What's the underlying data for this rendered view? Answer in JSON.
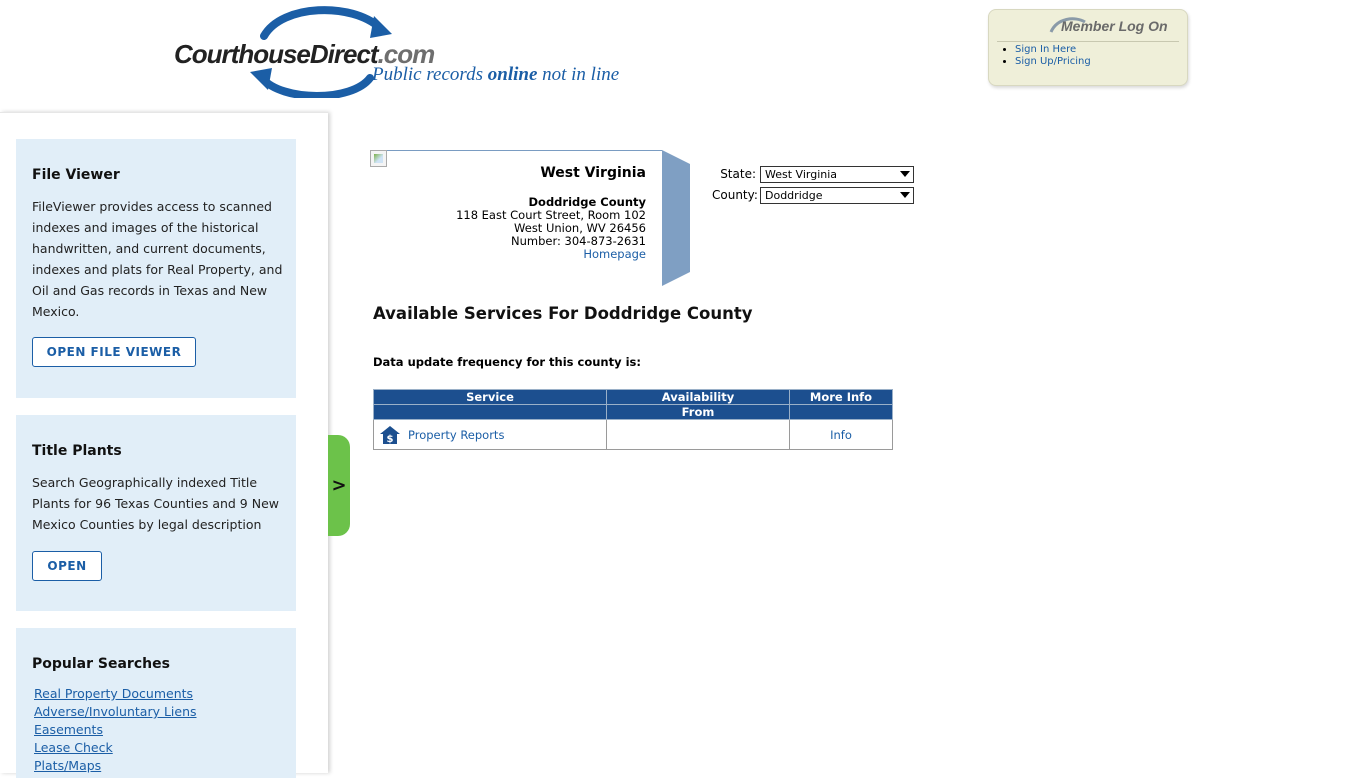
{
  "header": {
    "logo_word": "CourthouseDirect",
    "logo_dot": ".com",
    "tagline_a": "Public records ",
    "tagline_b": "online",
    "tagline_c": " not in line"
  },
  "member": {
    "title": "Member Log On",
    "links": [
      "Sign In Here",
      "Sign Up/Pricing"
    ]
  },
  "sidebar": {
    "file_viewer": {
      "title": "File Viewer",
      "text": "FileViewer provides access to scanned indexes and images of the historical handwritten, and current documents, indexes and plats for Real Property, and Oil and Gas records in Texas and New Mexico.",
      "button": "OPEN FILE VIEWER"
    },
    "title_plants": {
      "title": "Title Plants",
      "text": "Search Geographically indexed Title Plants for 96 Texas Counties and 9 New Mexico Counties by legal description",
      "button": "OPEN"
    },
    "popular": {
      "title": "Popular Searches",
      "links": [
        "Real Property Documents",
        "Adverse/Involuntary Liens",
        "Easements",
        "Lease Check",
        "Plats/Maps"
      ]
    },
    "toggle": ">"
  },
  "county": {
    "state": "West Virginia",
    "name": "Doddridge County",
    "address1": "118 East Court Street, Room 102",
    "address2": "West Union, WV 26456",
    "phone": "Number: 304-873-2631",
    "homepage": "Homepage"
  },
  "selectors": {
    "state_label": "State:",
    "state_value": "West Virginia",
    "county_label": "County:",
    "county_value": "Doddridge"
  },
  "main": {
    "title": "Available Services For Doddridge County",
    "frequency": "Data update frequency for this county is:"
  },
  "table": {
    "headers": [
      "Service",
      "Availability",
      "More Info"
    ],
    "subheader": "From",
    "rows": [
      {
        "service": "Property Reports",
        "availability": "",
        "info": "Info",
        "icon": "house-dollar-icon"
      }
    ]
  },
  "colors": {
    "brand_blue": "#1b5ea6",
    "table_header": "#1c4f8f",
    "card_bg": "#e1eef8",
    "toggle_green": "#6cc24a"
  }
}
